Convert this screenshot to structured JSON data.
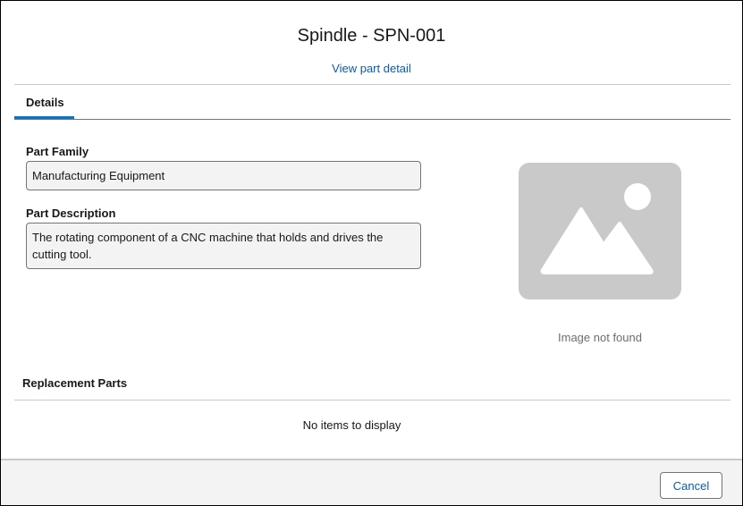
{
  "header": {
    "title": "Spindle - SPN-001",
    "detail_link": "View part detail"
  },
  "tabs": [
    {
      "label": "Details",
      "active": true
    }
  ],
  "details": {
    "part_family": {
      "label": "Part Family",
      "value": "Manufacturing Equipment"
    },
    "part_description": {
      "label": "Part Description",
      "value": "The rotating component of a CNC machine that holds and drives the cutting tool."
    },
    "image": {
      "icon": "image-placeholder-icon",
      "caption": "Image not found"
    }
  },
  "replacement_parts": {
    "title": "Replacement Parts",
    "empty_message": "No items to display",
    "items": []
  },
  "footer": {
    "cancel_label": "Cancel"
  },
  "colors": {
    "link": "#0b5cab",
    "active_tab": "#0176d3",
    "field_background": "#f3f3f3",
    "placeholder_gray": "#c9c9c9",
    "caption_gray": "#706e6b"
  }
}
